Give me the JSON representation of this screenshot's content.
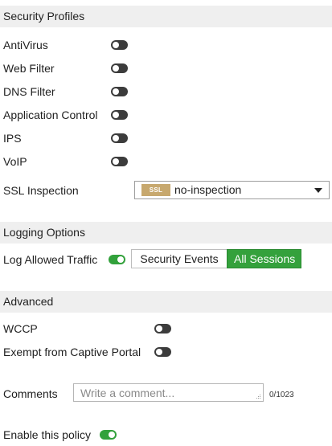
{
  "security_profiles": {
    "header": "Security Profiles",
    "items": [
      {
        "label": "AntiVirus",
        "enabled": false
      },
      {
        "label": "Web Filter",
        "enabled": false
      },
      {
        "label": "DNS Filter",
        "enabled": false
      },
      {
        "label": "Application Control",
        "enabled": false
      },
      {
        "label": "IPS",
        "enabled": false
      },
      {
        "label": "VoIP",
        "enabled": false
      }
    ],
    "ssl_inspection": {
      "label": "SSL Inspection",
      "badge": "SSL",
      "value": "no-inspection"
    }
  },
  "logging_options": {
    "header": "Logging Options",
    "log_allowed_traffic": {
      "label": "Log Allowed Traffic",
      "enabled": true
    },
    "options": [
      "Security Events",
      "All Sessions"
    ],
    "selected": "All Sessions"
  },
  "advanced": {
    "header": "Advanced",
    "items": [
      {
        "label": "WCCP",
        "enabled": false
      },
      {
        "label": "Exempt from Captive Portal",
        "enabled": false
      }
    ]
  },
  "comments": {
    "label": "Comments",
    "placeholder": "Write a comment...",
    "counter": "0/1023"
  },
  "enable_policy": {
    "label": "Enable this policy",
    "enabled": true
  },
  "colors": {
    "toggle_on": "#32a13b",
    "toggle_off": "#3c3c3c",
    "ssl_badge": "#c7a86e",
    "section_bg": "#efefef"
  }
}
